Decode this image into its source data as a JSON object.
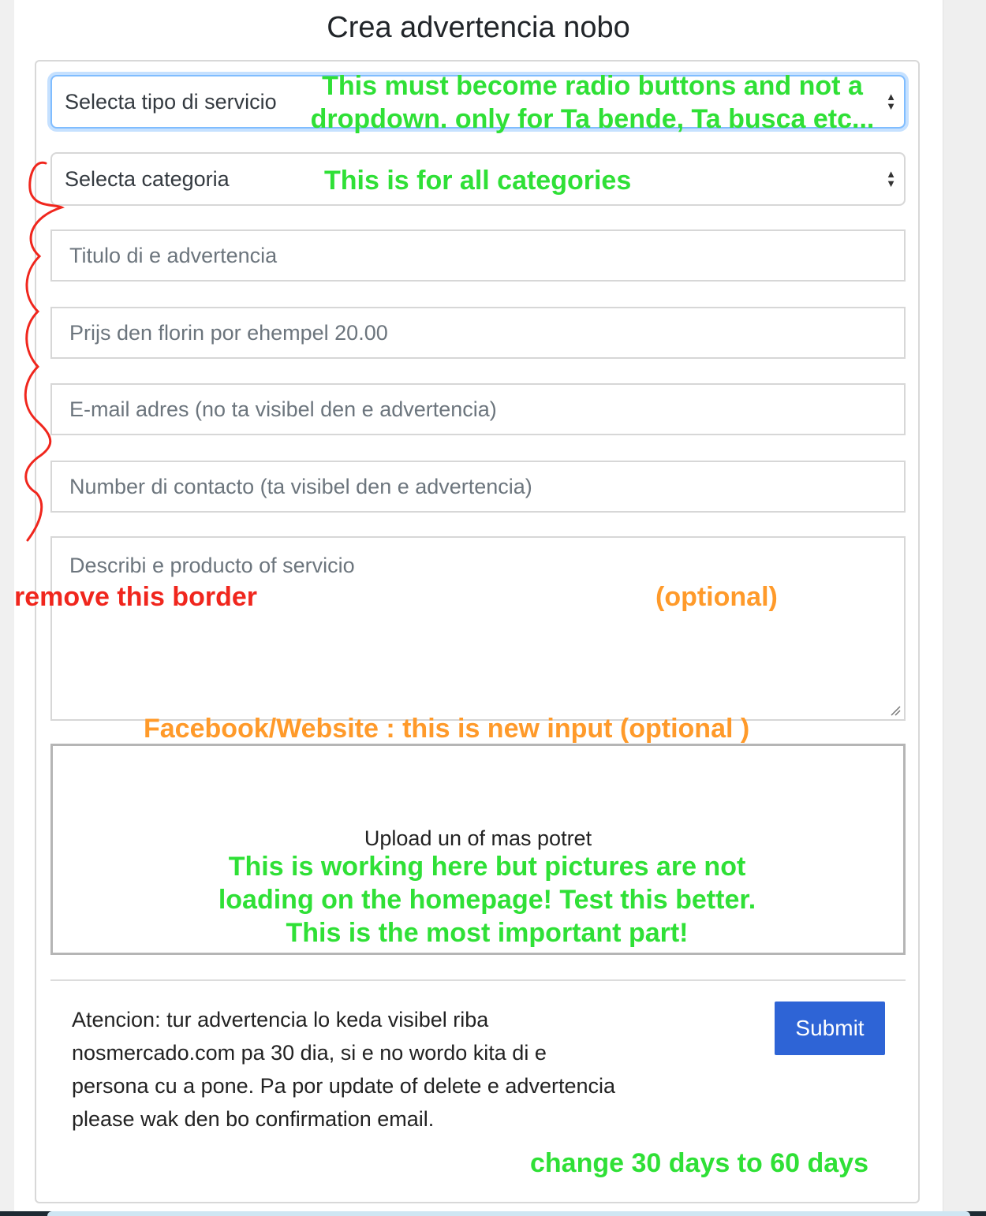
{
  "page": {
    "title": "Crea advertencia nobo"
  },
  "form": {
    "service_type": {
      "placeholder": "Selecta tipo di servicio"
    },
    "category": {
      "placeholder": "Selecta categoria"
    },
    "title_field": {
      "placeholder": "Titulo di e advertencia"
    },
    "price_field": {
      "placeholder": "Prijs den florin por ehempel 20.00"
    },
    "email_field": {
      "placeholder": "E-mail adres (no ta visibel den e advertencia)"
    },
    "contact_field": {
      "placeholder": "Number di contacto (ta visibel den e advertencia)"
    },
    "description_field": {
      "placeholder": "Describi e producto of servicio"
    },
    "upload": {
      "label": "Upload un of mas potret"
    },
    "notice": "Atencion: tur advertencia lo keda visibel riba nosmercado.com pa 30 dia, si e no wordo kita di e persona cu a pone. Pa por update of delete e advertencia please wak den bo confirmation email.",
    "submit_label": "Submit"
  },
  "annotations": {
    "radio_note": "This must become radio buttons and not a dropdown. only for Ta bende, Ta busca etc...",
    "categories_note": "This is for all categories",
    "border_note": "remove this border",
    "optional_note": "(optional)",
    "facebook_note": "Facebook/Website : this is new input (optional )",
    "upload_note": "This is working here but pictures are not loading on the homepage! Test this better. This is the most important part!",
    "days_note": "change 30 days to 60 days"
  },
  "colors": {
    "annotation_green": "#2fe036",
    "annotation_orange": "#ff9a2a",
    "annotation_red": "#f0261d",
    "submit_blue": "#2e64d6",
    "focus_blue": "#80bdff"
  },
  "icons": {
    "select_arrows": "up-down-arrows-icon",
    "resize_grip": "resize-grip-icon"
  }
}
